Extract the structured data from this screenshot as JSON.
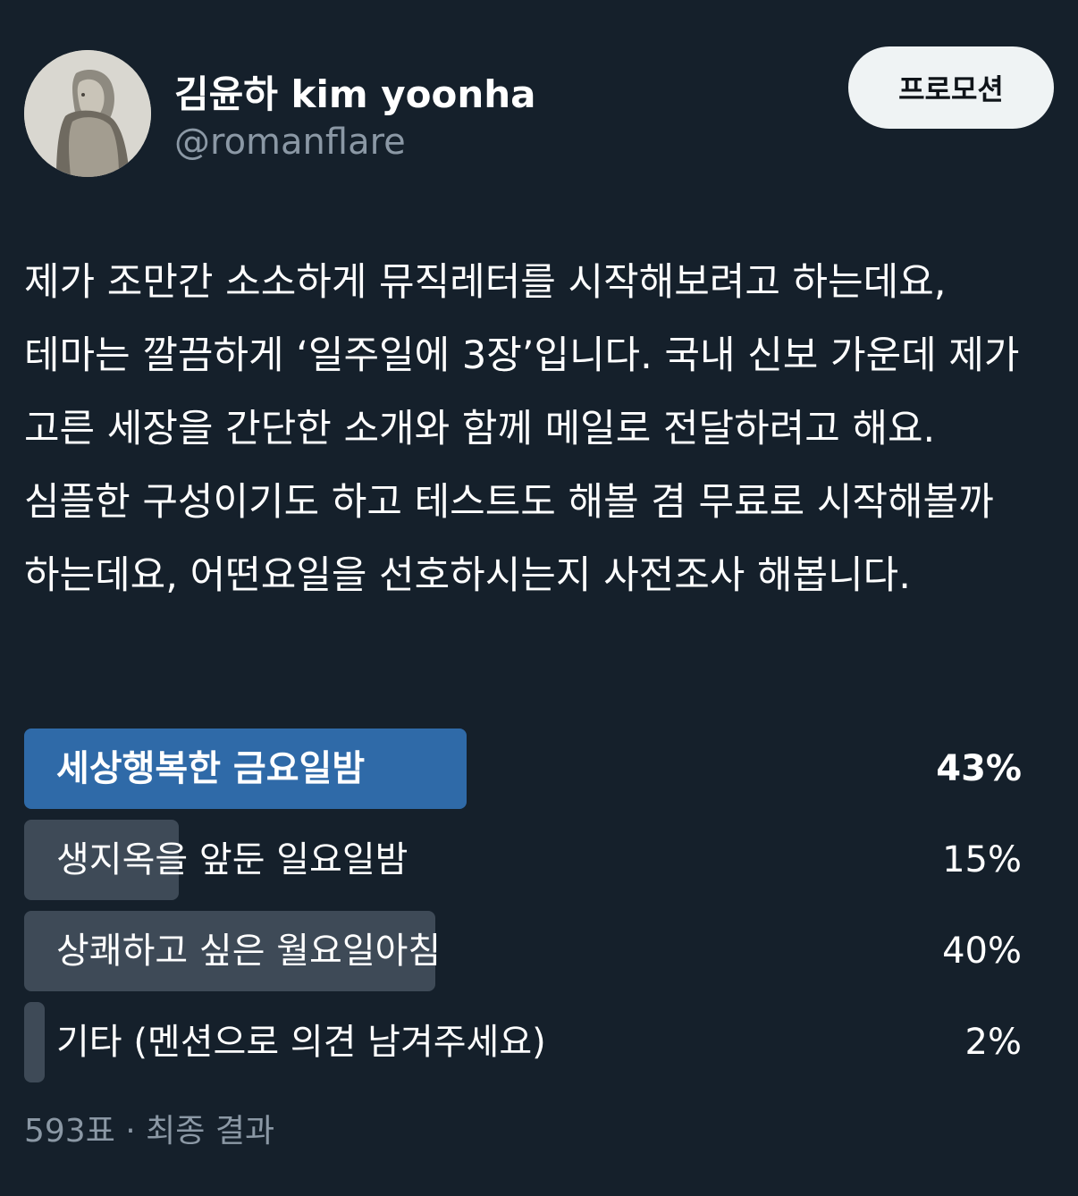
{
  "header": {
    "display_name": "김윤하 kim yoonha",
    "handle": "@romanflare",
    "promo_button_label": "프로모션"
  },
  "tweet": {
    "text": "제가 조만간 소소하게 뮤직레터를 시작해보려고 하는데요, 테마는 깔끔하게 ‘일주일에 3장’입니다. 국내 신보 가운데 제가 고른 세장을 간단한 소개와 함께 메일로 전달하려고 해요. 심플한 구성이기도 하고 테스트도 해볼 겸 무료로 시작해볼까 하는데요, 어떤요일을 선호하시는지 사전조사 해봅니다."
  },
  "poll": {
    "options": [
      {
        "label": "세상행복한 금요일밤",
        "percent_label": "43%",
        "percent": 43,
        "winner": true
      },
      {
        "label": "생지옥을 앞둔 일요일밤",
        "percent_label": "15%",
        "percent": 15,
        "winner": false
      },
      {
        "label": "상쾌하고 싶은 월요일아침",
        "percent_label": "40%",
        "percent": 40,
        "winner": false
      },
      {
        "label": "기타 (멘션으로 의견 남겨주세요)",
        "percent_label": "2%",
        "percent": 2,
        "winner": false
      }
    ],
    "footer": "593표 · 최종 결과"
  },
  "colors": {
    "background": "#15202b",
    "winner_bar": "#2f6aa8",
    "other_bar": "#3e4a57",
    "secondary_text": "#8b98a5"
  }
}
